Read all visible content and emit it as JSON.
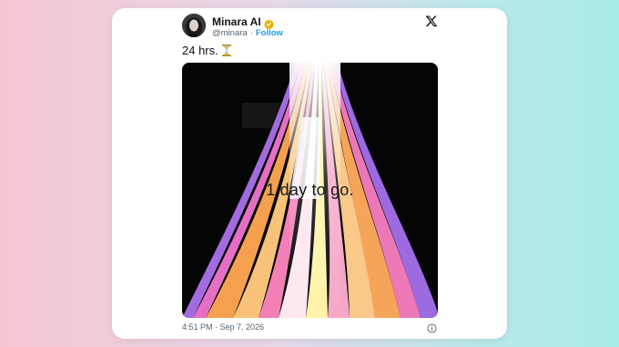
{
  "tweet": {
    "display_name": "Minara AI",
    "handle": "@minara",
    "separator": "·",
    "follow_label": "Follow",
    "text": "24 hrs.",
    "emoji_icon": "hourglass-icon",
    "media_caption": "1 day to go.",
    "timestamp": "4:51 PM · Sep 7, 2026"
  },
  "colors": {
    "accent": "#1d9bf0",
    "verified_badge": "#e9b10a",
    "text_primary": "#0f1419",
    "text_secondary": "#536471"
  },
  "icons": {
    "brand": "x-logo-icon",
    "verified": "verified-badge-icon",
    "info": "info-icon"
  }
}
